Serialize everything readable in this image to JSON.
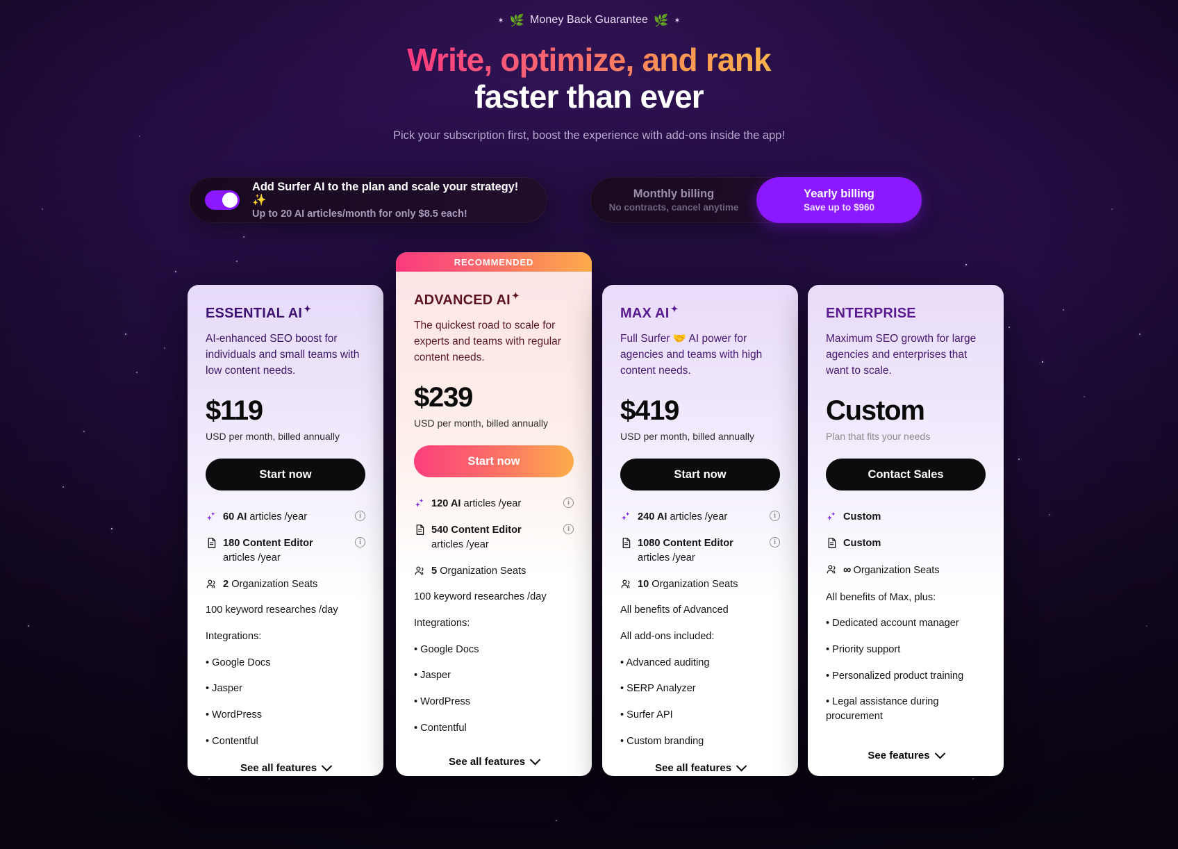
{
  "header": {
    "guarantee": "Money Back Guarantee",
    "laurel_icon": "laurel-wreath-icon",
    "star_icon": "star-icon",
    "headline_gradient": "Write, optimize, and rank",
    "headline_white": "faster than ever",
    "subhead": "Pick your subscription first, boost the experience with add-ons inside the app!"
  },
  "ai_addon": {
    "title": "Add Surfer AI to the plan and scale your strategy! ✨",
    "subtitle": "Up to 20 AI articles/month for only $8.5 each!",
    "toggle_on": true
  },
  "billing": {
    "monthly_label": "Monthly billing",
    "monthly_sub": "No contracts, cancel anytime",
    "yearly_label": "Yearly billing",
    "yearly_sub": "Save up to $960",
    "selected": "yearly",
    "accent": "#8b18ff"
  },
  "ribbon": {
    "label": "RECOMMENDED"
  },
  "plans": [
    {
      "name": "ESSENTIAL AI",
      "desc": "AI-enhanced SEO boost for individuals and small teams with low content needs.",
      "price": "$119",
      "price_note": "USD per month, billed annually",
      "cta": "Start now",
      "ai_count": "60 AI",
      "ai_rest": "articles /year",
      "ce_count": "180 Content Editor",
      "ce_rest": "articles /year",
      "seats_count": "2",
      "seats_rest": "Organization Seats",
      "keyword": "100 keyword researches /day",
      "integrations_label": "Integrations:",
      "bullets": [
        "• Google Docs",
        "• Jasper",
        "• WordPress",
        "• Contentful"
      ],
      "footer": "See all features"
    },
    {
      "name": "ADVANCED AI",
      "desc": "The quickest road to scale for experts and teams with regular content needs.",
      "price": "$239",
      "price_note": "USD per month, billed annually",
      "cta": "Start now",
      "ai_count": "120 AI",
      "ai_rest": "articles /year",
      "ce_count": "540 Content Editor",
      "ce_rest": "articles /year",
      "seats_count": "5",
      "seats_rest": "Organization Seats",
      "keyword": "100 keyword researches /day",
      "integrations_label": "Integrations:",
      "bullets": [
        "• Google Docs",
        "• Jasper",
        "• WordPress",
        "• Contentful"
      ],
      "footer": "See all features"
    },
    {
      "name": "MAX AI",
      "desc": "Full Surfer 🤝 AI power for agencies and teams with high content needs.",
      "price": "$419",
      "price_note": "USD per month, billed annually",
      "cta": "Start now",
      "ai_count": "240 AI",
      "ai_rest": "articles /year",
      "ce_count": "1080 Content Editor",
      "ce_rest": "articles /year",
      "seats_count": "10",
      "seats_rest": "Organization Seats",
      "benefits_line": "All benefits of Advanced",
      "addons_label": "All add-ons included:",
      "bullets": [
        "• Advanced auditing",
        "• SERP Analyzer",
        "• Surfer API",
        "• Custom branding"
      ],
      "footer": "See all features"
    },
    {
      "name": "ENTERPRISE",
      "desc": "Maximum SEO growth for large agencies and enterprises that want to scale.",
      "price": "Custom",
      "price_note": "Plan that fits your needs",
      "cta": "Contact Sales",
      "ai_count": "Custom",
      "ce_count": "Custom",
      "seats_symbol": "∞",
      "seats_rest": "Organization Seats",
      "benefits_line": "All benefits of Max, plus:",
      "bullets": [
        "• Dedicated account manager",
        "• Priority support",
        "• Personalized product training",
        "• Legal assistance during procurement"
      ],
      "footer": "See features"
    }
  ],
  "icons": {
    "sparkle": "sparkle-icon",
    "document": "document-icon",
    "users": "users-icon",
    "info": "i",
    "chevron": "chevron-down-icon"
  }
}
